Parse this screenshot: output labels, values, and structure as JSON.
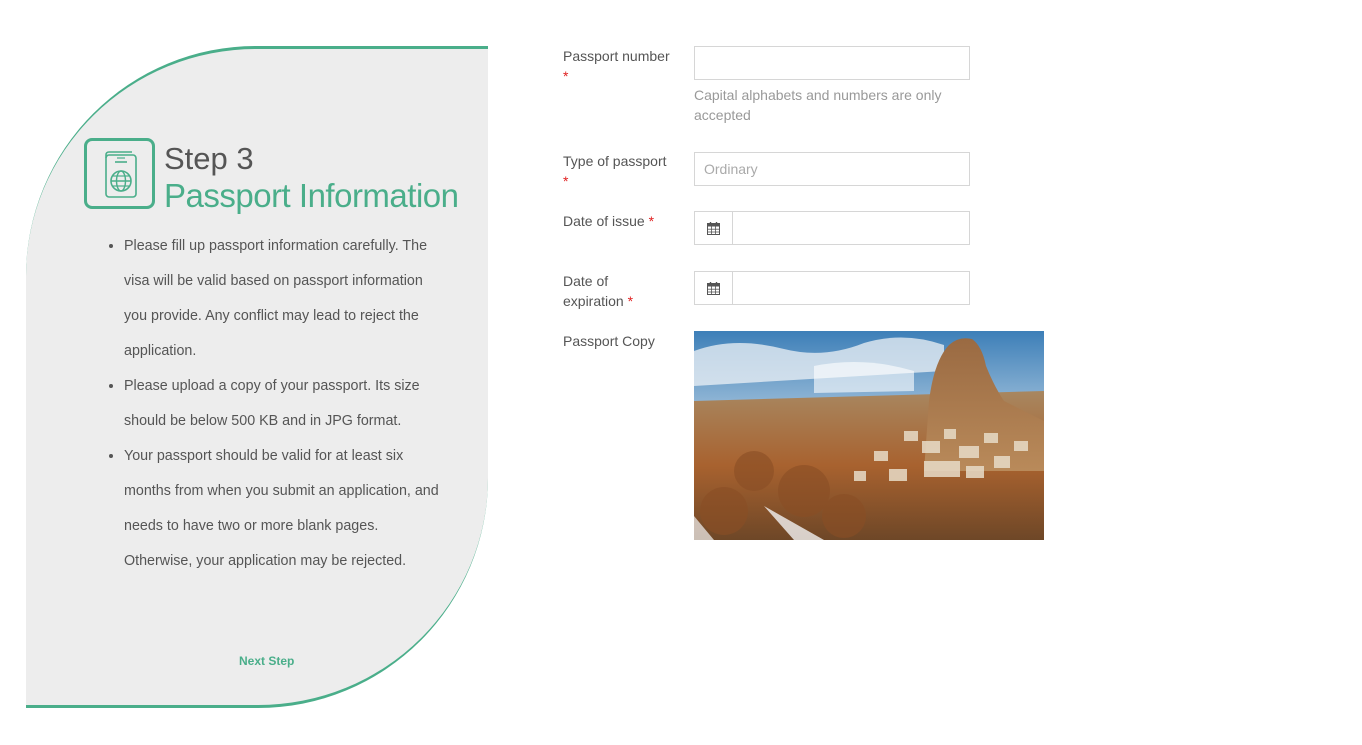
{
  "sidebar": {
    "step_number": "Step 3",
    "step_title": "Passport Information",
    "icon": "passport-icon",
    "bullets": [
      "Please fill up passport information carefully. The visa will be valid based on passport information you provide. Any conflict may lead to reject the application.",
      "Please upload a copy of your passport. Its size should be below 500 KB and in JPG format.",
      "Your passport should be valid for at least six months from when you submit an application, and needs to have two or more blank pages. Otherwise, your application may be rejected."
    ],
    "next_label": "Next Step"
  },
  "form": {
    "passport_number": {
      "label": "Passport number",
      "required_mark": "*",
      "value": "",
      "help": "Capital alphabets and numbers are only accepted"
    },
    "passport_type": {
      "label": "Type of passport",
      "required_mark": "*",
      "placeholder": "Ordinary"
    },
    "date_of_issue": {
      "label": "Date of issue",
      "required_mark": "*",
      "value": "",
      "icon": "calendar-icon"
    },
    "date_of_expiration": {
      "label_line1": "Date of",
      "label_line2": "expiration",
      "required_mark": "*",
      "value": "",
      "icon": "calendar-icon"
    },
    "passport_copy": {
      "label": "Passport Copy"
    }
  },
  "colors": {
    "accent": "#4aae8a",
    "panel_bg": "#ededed",
    "required": "#e02020",
    "help_text": "#999999"
  }
}
